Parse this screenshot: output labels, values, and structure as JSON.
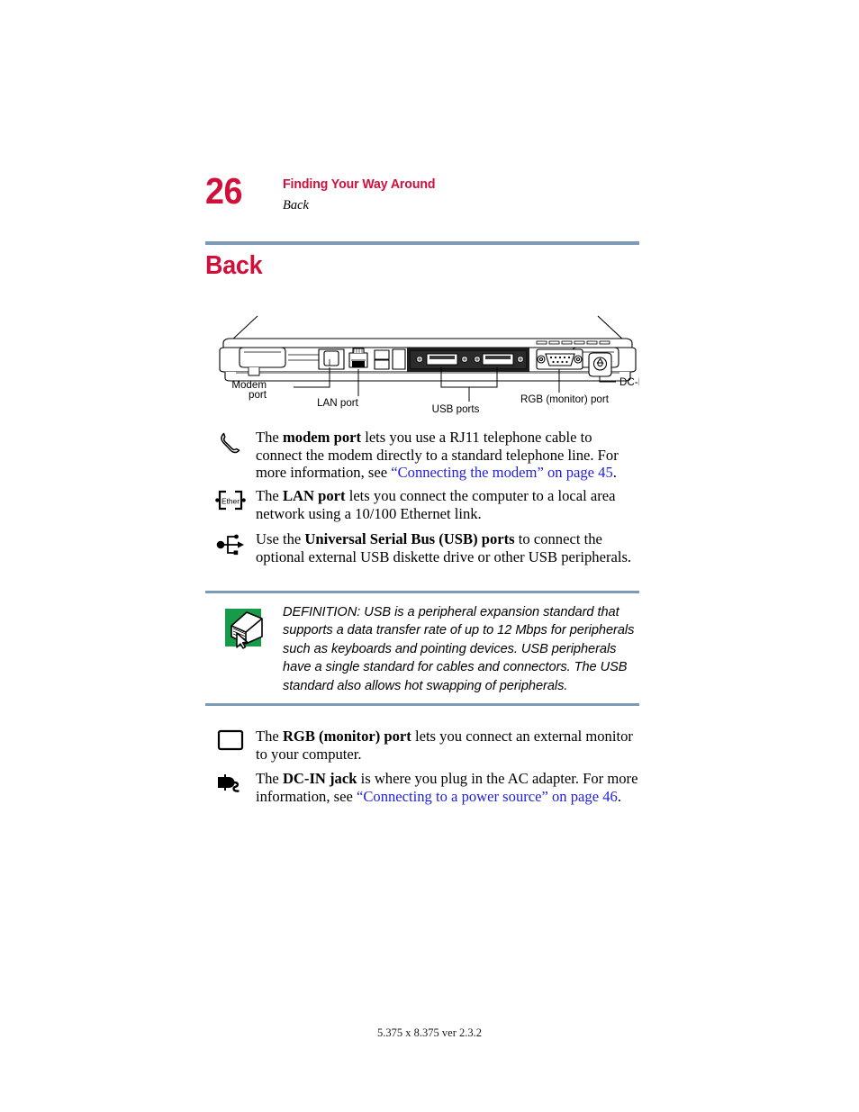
{
  "header": {
    "page_number": "26",
    "chapter_title": "Finding Your Way Around",
    "section_subtitle": "Back",
    "heading": "Back",
    "rule_color": "#7E9AB4",
    "accent_color": "#D0103A"
  },
  "figure": {
    "name": "laptop-back-panel-diagram",
    "callouts": {
      "modem_line1": "Modem",
      "modem_line2": "port",
      "lan": "LAN port",
      "usb": "USB ports",
      "rgb": "RGB (monitor) port",
      "dcin": "DC-IN jack"
    }
  },
  "items": {
    "modem": {
      "icon": "telephone-handset-icon",
      "lead": "The ",
      "term": "modem port",
      "body_1": " lets you use a RJ11 telephone cable to connect the modem directly to a standard telephone line. For more information, see ",
      "link": "“Connecting the modem” on page 45",
      "body_2": "."
    },
    "lan": {
      "icon": "ethernet-port-icon",
      "icon_label": "Ether",
      "lead": "The ",
      "term": "LAN port",
      "body_1": " lets you connect the computer to a local area network using a 10/100 Ethernet link."
    },
    "usb": {
      "icon": "usb-trident-icon",
      "lead": "Use the ",
      "term": "Universal Serial Bus (USB) ports",
      "body_1": " to connect the optional external USB diskette drive or other USB peripherals."
    },
    "rgb": {
      "icon": "monitor-outline-icon",
      "lead": "The ",
      "term": "RGB (monitor) port",
      "body_1": " lets you connect an external monitor to your computer."
    },
    "dcin": {
      "icon": "power-plug-icon",
      "lead": "The ",
      "term": "DC-IN jack",
      "body_1": " is where you plug in the AC adapter. For more information, see ",
      "link": "“Connecting to a power source” on page 46",
      "body_2": "."
    }
  },
  "callout": {
    "icon": "definition-book-icon",
    "icon_color": "#169B4A",
    "text": "DEFINITION: USB is a peripheral expansion standard that supports a data transfer rate of up to 12 Mbps for peripherals such as keyboards and pointing devices. USB peripherals have a single standard for cables and connectors. The USB standard also allows hot swapping of peripherals."
  },
  "footer": {
    "text": "5.375 x 8.375 ver 2.3.2"
  },
  "colors": {
    "link": "#2222DD",
    "rule": "#7E9AB4",
    "red": "#D0103A",
    "green": "#169B4A"
  }
}
